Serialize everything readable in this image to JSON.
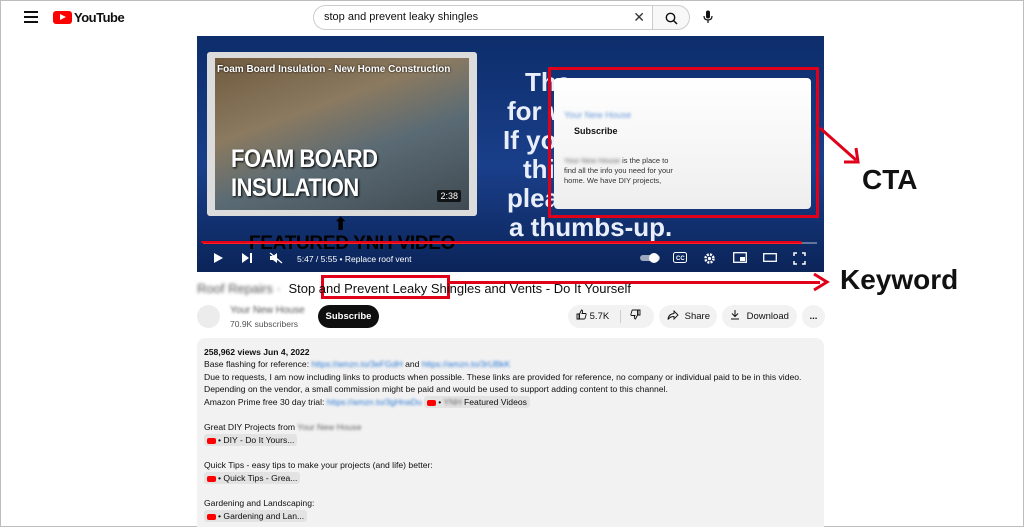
{
  "header": {
    "logo_text": "YouTube",
    "search_value": "stop and prevent leaky shingles"
  },
  "video": {
    "inset_title": "Foam Board Insulation - New Home Construction",
    "inset_line1": "FOAM BOARD",
    "inset_line2": "INSULATION",
    "inset_duration": "2:38",
    "featured_text": "FEATURED YNH VIDEO",
    "big_lines": [
      "Tha",
      "for w",
      "If you",
      "this",
      "pleas",
      "a thumbs-up."
    ],
    "end_card": {
      "subscribe_label": "Subscribe",
      "desc_rest": "is the place to find all the info you need for your home. We have DIY projects,"
    },
    "time_text": "5:47 / 5:55 • Replace roof vent",
    "progress": 0.975
  },
  "annotations": {
    "cta_label": "CTA",
    "keyword_label": "Keyword"
  },
  "title": {
    "part1": "Stop and",
    "keyword": "Prevent Leaky Shingles",
    "part2": "and Vents - Do It Yourself"
  },
  "channel": {
    "subscribers": "70.9K subscribers",
    "subscribe_label": "Subscribe"
  },
  "actions": {
    "likes": "5.7K",
    "share": "Share",
    "download": "Download",
    "more": "..."
  },
  "description": {
    "stats": "258,962 views  Jun 4, 2022",
    "line1": "Base flashing for reference:",
    "line1_and": "and",
    "line2": "Due to requests, I am now including links to products when possible. These links are provided for reference, no company or individual paid to be in this video.",
    "line3": "Depending on the vendor, a small commission might be paid and would be used to support adding content to this channel.",
    "line4": "Amazon Prime free 30 day trial:",
    "line4_chip": "Featured Videos",
    "sec1_title": "Great DIY Projects from",
    "sec1_chip": "• DIY - Do It Yours...",
    "sec2_title": "Quick Tips - easy tips to make your projects (and life) better:",
    "sec2_chip": "• Quick Tips - Grea...",
    "sec3_title": "Gardening and Landscaping:",
    "sec3_chip": "• Gardening and Lan..."
  }
}
